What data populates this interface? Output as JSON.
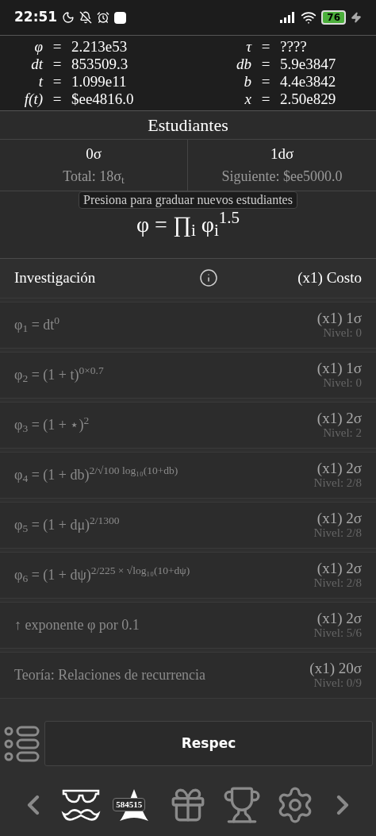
{
  "status_bar": {
    "time": "22:51",
    "battery": "76",
    "charging": true
  },
  "variables": [
    {
      "symbol": "φ",
      "operator": "=",
      "value": "2.213e53"
    },
    {
      "symbol": "τ",
      "operator": "=",
      "value": "????"
    },
    {
      "symbol": "dt",
      "operator": "=",
      "value": "853509.3"
    },
    {
      "symbol": "db",
      "operator": "=",
      "value": "5.9e3847"
    },
    {
      "symbol": "t",
      "operator": "=",
      "value": "1.099e11"
    },
    {
      "symbol": "b",
      "operator": "=",
      "value": "4.4e3842"
    },
    {
      "symbol": "f(t)",
      "operator": "=",
      "value": "$ee4816.0"
    },
    {
      "symbol": "x",
      "operator": "=",
      "value": "2.50e829"
    }
  ],
  "students": {
    "title": "Estudiantes",
    "available": "0σ",
    "total": "Total: 18σ$_{t}$",
    "rate": "1dσ",
    "next": "Siguiente: $ee5000.0",
    "tooltip": "Presiona para graduar nuevos estudiantes",
    "formula": "φ = ∏$_{i}$ φ$_{i}$$^{1.5}$"
  },
  "research": {
    "title": "Investigación",
    "cost_header": "(x1) Costo"
  },
  "upgrades": [
    {
      "label": "φ$_{1}$ = dt$^{0}$",
      "cost": "(x1) 1σ",
      "level": "Nivel: 0",
      "disabled": true
    },
    {
      "label": "φ$_{2}$ = (1 + t)$^{0×0.7}$",
      "cost": "(x1) 1σ",
      "level": "Nivel: 0",
      "disabled": true
    },
    {
      "label": "φ$_{3}$ = (1 + ⋆)$^{2}$",
      "cost": "(x1) 2σ",
      "level": "Nivel: 2",
      "disabled": true
    },
    {
      "label": "φ$_{4}$ = (1 + db)$^{2/√100 log₁₀(10+db)}$",
      "cost": "(x1) 2σ",
      "level": "Nivel: 2/8",
      "disabled": true
    },
    {
      "label": "φ$_{5}$ = (1 + dμ)$^{2/1300}$",
      "cost": "(x1) 2σ",
      "level": "Nivel: 2/8",
      "disabled": true
    },
    {
      "label": "φ$_{6}$ = (1 + dψ)$^{2/225 × √log₁₀(10+dψ)}$",
      "cost": "(x1) 2σ",
      "level": "Nivel: 2/8",
      "disabled": true
    },
    {
      "label": "↑ exponente φ por 0.1",
      "cost": "(x1) 2σ",
      "level": "Nivel: 5/6",
      "disabled": true
    },
    {
      "label": "Teoría: Relaciones de recurrencia",
      "cost": "(x1) 20σ",
      "level": "Nivel: 0/9",
      "disabled": true
    }
  ],
  "respec_button": "Respec",
  "nav": [
    {
      "kind": "students",
      "active": true
    },
    {
      "kind": "star",
      "active": true,
      "badge": "584515"
    },
    {
      "kind": "gift",
      "active": false
    },
    {
      "kind": "trophy",
      "active": false
    },
    {
      "kind": "settings",
      "active": false
    }
  ]
}
